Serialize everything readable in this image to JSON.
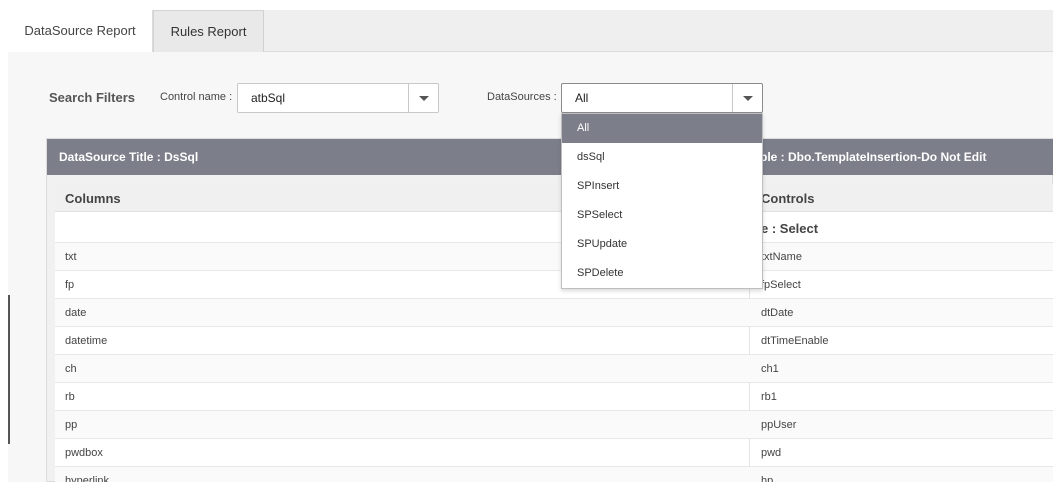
{
  "tabs": [
    {
      "label": "DataSource Report"
    },
    {
      "label": "Rules Report"
    }
  ],
  "filters": {
    "title": "Search Filters",
    "control_label": "Control name :",
    "control_value": "atbSql",
    "datasource_label": "DataSources :",
    "datasource_value": "All",
    "datasource_options": [
      "All",
      "dsSql",
      "SPInsert",
      "SPSelect",
      "SPUpdate",
      "SPDelete"
    ]
  },
  "panel": {
    "title_left": "DataSource Title  :  DsSql",
    "title_right": "ble  :  Dbo.TemplateInsertion-Do Not Edit"
  },
  "table": {
    "col_columns": "Columns",
    "col_controls": "Controls",
    "subheader_right": "e  : Select",
    "rows": [
      {
        "column": "txt",
        "control": "txtName"
      },
      {
        "column": "fp",
        "control": "fpSelect"
      },
      {
        "column": "date",
        "control": "dtDate"
      },
      {
        "column": "datetime",
        "control": "dtTimeEnable"
      },
      {
        "column": "ch",
        "control": "ch1"
      },
      {
        "column": "rb",
        "control": "rb1"
      },
      {
        "column": "pp",
        "control": "ppUser"
      },
      {
        "column": "pwdbox",
        "control": "pwd"
      },
      {
        "column": "hyperlink",
        "control": "hp"
      }
    ]
  },
  "colors": {
    "header_bg": "#7c7f8a",
    "selected_option_bg": "#7c7f8a"
  }
}
